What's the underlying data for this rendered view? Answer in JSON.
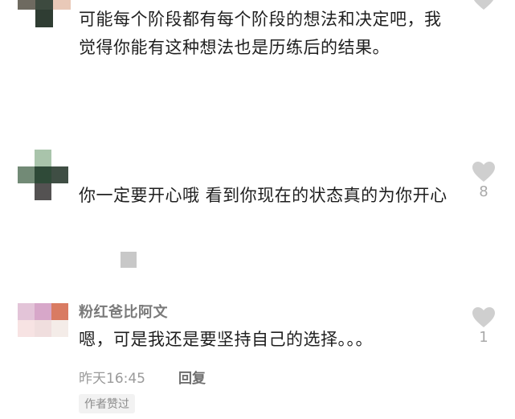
{
  "comments": [
    {
      "text": "可能每个阶段都有每个阶段的想法和决定吧，我觉得你能有这种想法也是历练后的结果。",
      "likes": ""
    },
    {
      "text": "你一定要开心哦 看到你现在的状态真的为你开心",
      "likes": "8"
    },
    {
      "username": "粉红爸比阿文",
      "text": "嗯，可是我还是要坚持自己的选择。。。",
      "likes": "1",
      "time": "昨天16:45",
      "reply_label": "回复",
      "badge": "作者赞过"
    }
  ],
  "colors": {
    "heart": "#cfcfcf",
    "username": "#7a7a7a",
    "text": "#1f1f1f"
  },
  "icons": [
    "heart-icon"
  ]
}
